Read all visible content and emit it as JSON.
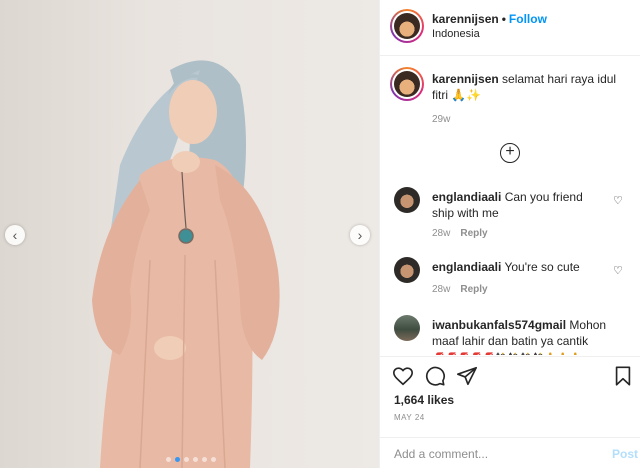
{
  "post": {
    "username": "karennijsen",
    "follow_label": "Follow",
    "location": "Indonesia",
    "separator": "•"
  },
  "caption": {
    "username": "karennijsen",
    "text": " selamat hari raya idul fitri 🙏✨",
    "time": "29w"
  },
  "load_more_icon": "plus-circle-icon",
  "comments": [
    {
      "username": "englandiaali",
      "text": " Can you friend ship with me",
      "time": "28w",
      "reply_label": "Reply"
    },
    {
      "username": "englandiaali",
      "text": " You're so cute",
      "time": "28w",
      "reply_label": "Reply"
    },
    {
      "username": "iwanbukanfals574gmail",
      "text": " Mohon maaf lahir dan batin ya cantik",
      "emoji_row": "💋💋💋💋💋🎎🎎🎎🎎🙏🙏🙏"
    }
  ],
  "actions": {
    "icons": [
      "heart-icon",
      "comment-icon",
      "share-icon",
      "save-icon"
    ]
  },
  "likes": "1,664 likes",
  "date": "MAY 24",
  "add_comment": {
    "placeholder": "Add a comment...",
    "post_label": "Post"
  },
  "carousel": {
    "prev_icon": "chevron-left-icon",
    "next_icon": "chevron-right-icon",
    "dot_count": 6,
    "active_dot": 2
  },
  "colors": {
    "accent": "#0095f6",
    "post_disabled": "#b2dffc",
    "dress": "#e8b9a5",
    "hijab": "#aebfc8"
  }
}
